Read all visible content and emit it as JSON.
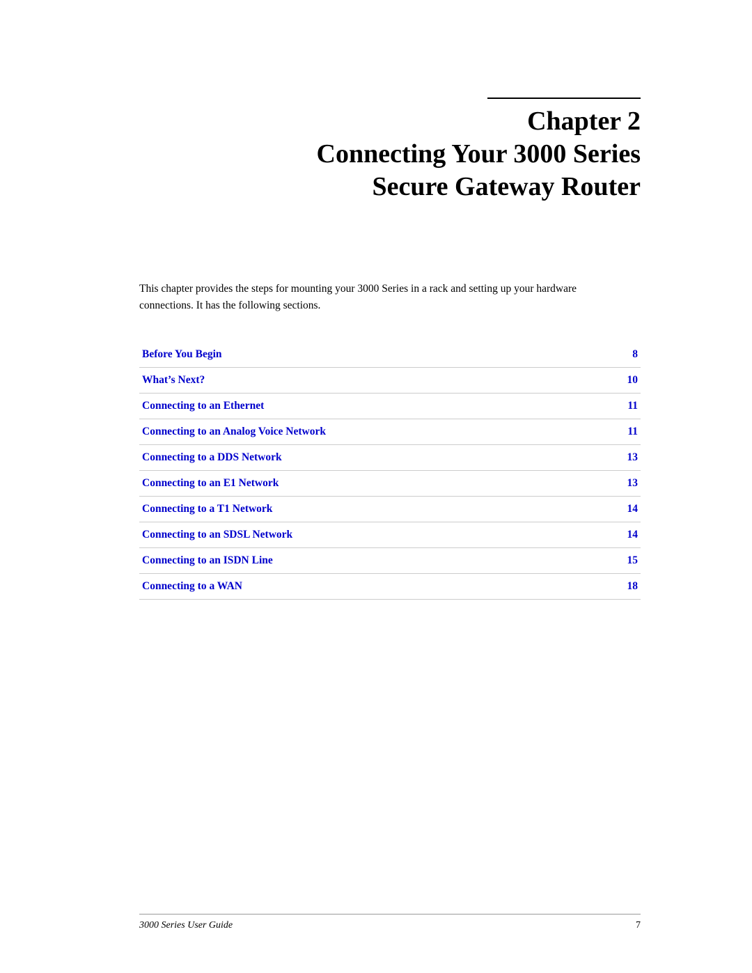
{
  "header": {
    "rule_visible": true,
    "chapter_number": "Chapter 2",
    "subtitle_line1": "Connecting Your 3000 Series",
    "subtitle_line2": "Secure Gateway Router"
  },
  "intro": {
    "text": "This chapter provides the steps for mounting your 3000 Series in a rack and setting up your hardware connections. It has the following sections."
  },
  "toc": {
    "items": [
      {
        "label": "Before You Begin",
        "page": "8"
      },
      {
        "label": "What’s Next?",
        "page": "10"
      },
      {
        "label": "Connecting to an Ethernet",
        "page": "11"
      },
      {
        "label": "Connecting to an Analog Voice Network",
        "page": "11"
      },
      {
        "label": "Connecting to a DDS Network",
        "page": "13"
      },
      {
        "label": "Connecting to an E1 Network",
        "page": "13"
      },
      {
        "label": "Connecting to a T1 Network",
        "page": "14"
      },
      {
        "label": "Connecting to an SDSL Network",
        "page": "14"
      },
      {
        "label": "Connecting to an ISDN Line",
        "page": "15"
      },
      {
        "label": "Connecting to a WAN",
        "page": "18"
      }
    ]
  },
  "footer": {
    "guide_name": "3000 Series User Guide",
    "page_number": "7"
  }
}
